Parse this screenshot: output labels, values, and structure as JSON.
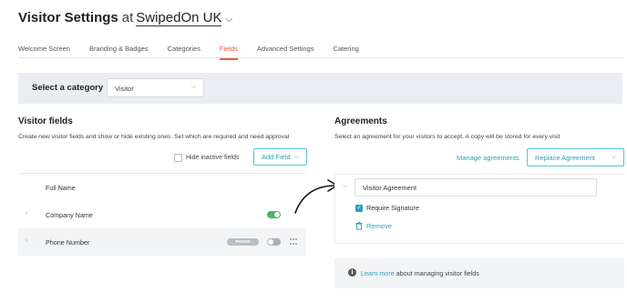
{
  "header": {
    "title": "Visitor Settings",
    "at": "at",
    "org": "SwipedOn UK"
  },
  "tabs": [
    {
      "label": "Welcome Screen"
    },
    {
      "label": "Branding & Badges"
    },
    {
      "label": "Categories"
    },
    {
      "label": "Fields"
    },
    {
      "label": "Advanced Settings"
    },
    {
      "label": "Catering"
    }
  ],
  "active_tab": "Fields",
  "category": {
    "label": "Select a category",
    "selected": "Visitor"
  },
  "visitor_fields": {
    "heading": "Visitor fields",
    "description": "Create new visitor fields and show or hide existing ones. Set which are required and need approval",
    "hide_inactive_label": "Hide inactive fields",
    "add_field_label": "Add Field",
    "rows": [
      {
        "name": "Full Name",
        "toggle": null
      },
      {
        "name": "Company Name",
        "toggle": "on"
      },
      {
        "name": "Phone Number",
        "toggle": "off",
        "badge": "PHONE"
      }
    ]
  },
  "agreements": {
    "heading": "Agreements",
    "description": "Select an agreement for your visitors to accept. A copy will be stored for every visit",
    "manage_label": "Manage agreements",
    "replace_label": "Replace Agreement",
    "agreement_name": "Visitor Agreement",
    "require_signature_label": "Require Signature",
    "remove_label": "Remove"
  },
  "info": {
    "link": "Learn more",
    "text": "about managing visitor fields"
  },
  "colors": {
    "accent": "#2ba0c1",
    "active_tab": "#e8613c",
    "toggle_on": "#45b36b"
  }
}
